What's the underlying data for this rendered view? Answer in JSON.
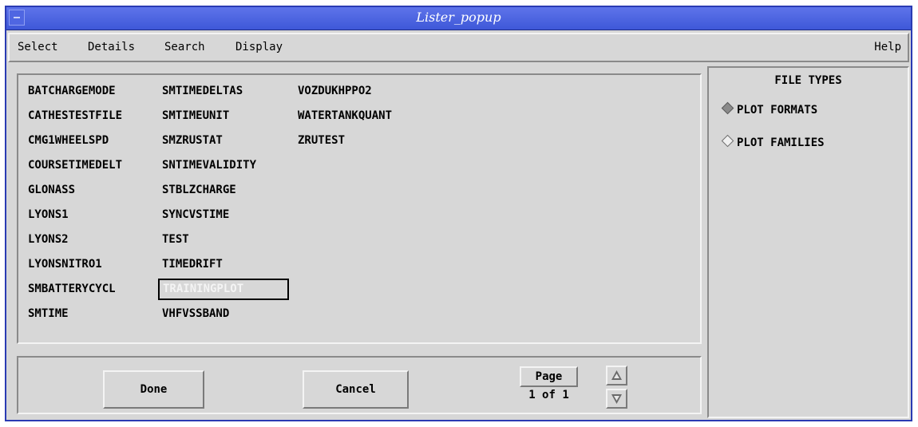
{
  "window": {
    "title": "Lister_popup"
  },
  "menu": {
    "select": "Select",
    "details": "Details",
    "search": "Search",
    "display": "Display",
    "help": "Help"
  },
  "list": {
    "columns": [
      [
        "BATCHARGEMODE",
        "CATHESTESTFILE",
        "CMG1WHEELSPD",
        "COURSETIMEDELT",
        "GLONASS",
        "LYONS1",
        "LYONS2",
        "LYONSNITRO1",
        "SMBATTERYCYCL",
        "SMTIME"
      ],
      [
        "SMTIMEDELTAS",
        "SMTIMEUNIT",
        "SMZRUSTAT",
        "SNTIMEVALIDITY",
        "STBLZCHARGE",
        "SYNCVSTIME",
        "TEST",
        "TIMEDRIFT",
        "TRAININGPLOT",
        "VHFVSSBAND"
      ],
      [
        "VOZDUKHPPO2",
        "WATERTANKQUANT",
        "ZRUTEST"
      ]
    ],
    "selected": "TRAININGPLOT"
  },
  "buttons": {
    "done": "Done",
    "cancel": "Cancel",
    "page": "Page",
    "page_info": "1 of 1"
  },
  "file_types": {
    "heading": "FILE TYPES",
    "options": [
      {
        "label": "PLOT FORMATS",
        "selected": true
      },
      {
        "label": "PLOT FAMILIES",
        "selected": false
      }
    ]
  },
  "colors": {
    "titlebar": "#4a62e0",
    "background": "#d7d7d7",
    "selection_text": "#f4f4f4"
  }
}
